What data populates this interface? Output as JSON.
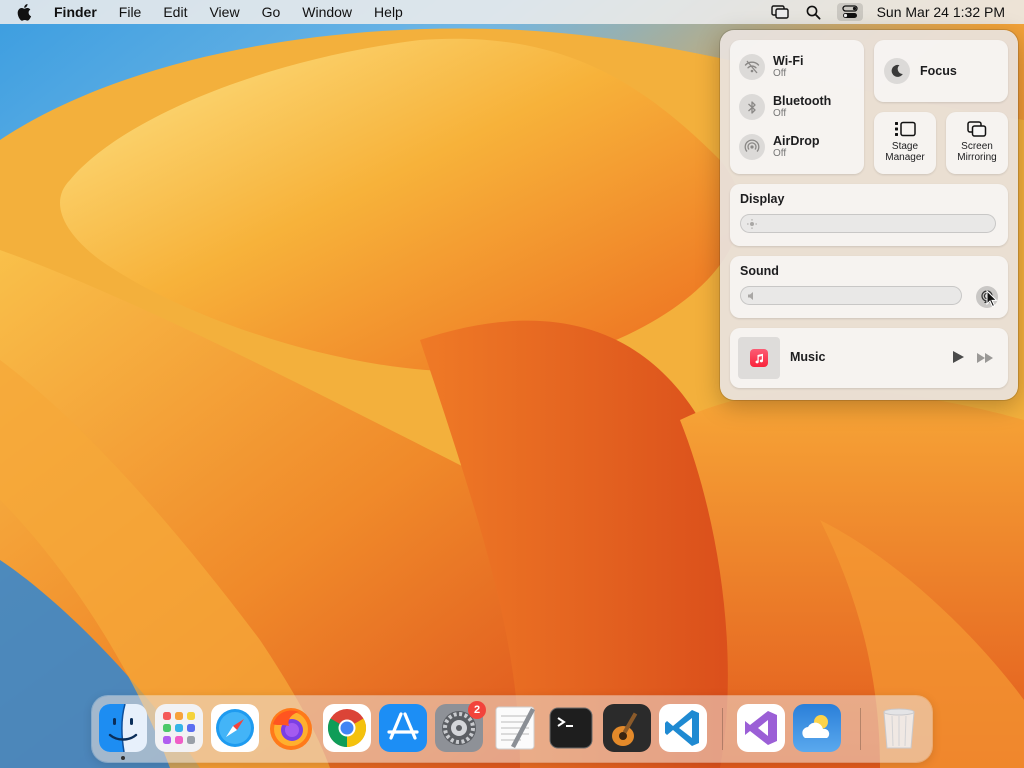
{
  "menubar": {
    "app_name": "Finder",
    "menus": [
      "File",
      "Edit",
      "View",
      "Go",
      "Window",
      "Help"
    ],
    "clock": "Sun Mar 24  1:32 PM"
  },
  "control_center": {
    "wifi": {
      "label": "Wi-Fi",
      "status": "Off"
    },
    "bluetooth": {
      "label": "Bluetooth",
      "status": "Off"
    },
    "airdrop": {
      "label": "AirDrop",
      "status": "Off"
    },
    "focus": {
      "label": "Focus"
    },
    "stage_manager": {
      "label": "Stage Manager"
    },
    "screen_mirroring": {
      "label": "Screen Mirroring"
    },
    "display": {
      "title": "Display",
      "brightness": 0
    },
    "sound": {
      "title": "Sound",
      "volume": 0
    },
    "music": {
      "title": "Music"
    }
  },
  "dock": {
    "settings_badge": "2",
    "items": [
      "finder-icon",
      "launchpad-icon",
      "safari-icon",
      "firefox-icon",
      "chrome-icon",
      "app-store-icon",
      "system-settings-icon",
      "textedit-icon",
      "terminal-icon",
      "garageband-icon",
      "vscode-icon",
      "visual-studio-icon",
      "weather-icon",
      "trash-icon"
    ]
  },
  "colors": {
    "accent_badge": "#f2433b",
    "music_red": "#fa233b"
  }
}
